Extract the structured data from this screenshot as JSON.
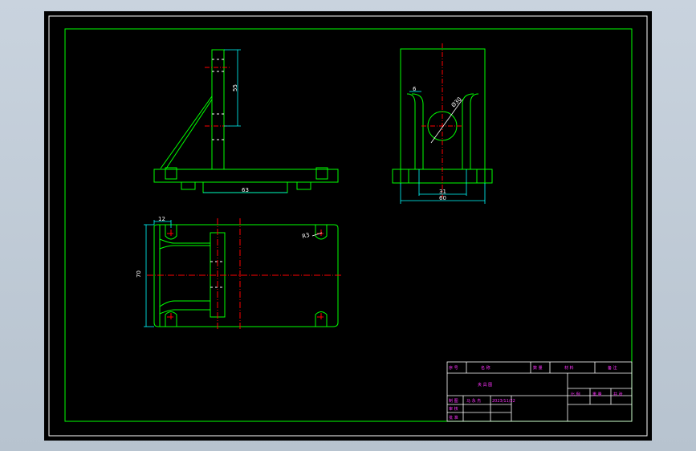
{
  "colors": {
    "background": "#000000",
    "outline": "#00ff00",
    "center_line": "#ff0000",
    "dimension": "#ffffff",
    "title_text": "#ff33ff",
    "hidden": "#ffffff",
    "dim_line": "#00ffff"
  },
  "dimensions": {
    "front_height": "55",
    "front_base_slot": "63",
    "side_top_small": "6",
    "side_bore": "Ø30",
    "side_inner": "31",
    "side_width": "60",
    "plan_slot_offset": "12",
    "plan_height": "70",
    "plan_corner": "R3"
  },
  "title_block": {
    "row1": [
      "序 号",
      "名 称",
      "数 量",
      "材 料",
      "备 注"
    ],
    "drawing_name": "夹 具 图",
    "scale_cells": [
      "比 例",
      "重 量",
      "共 张"
    ],
    "designer_label": "制 图",
    "designer_name": "马 永 杰",
    "designer_date": "2023/11/22",
    "reviewer_label": "审 核",
    "approver_label": "批 准"
  }
}
